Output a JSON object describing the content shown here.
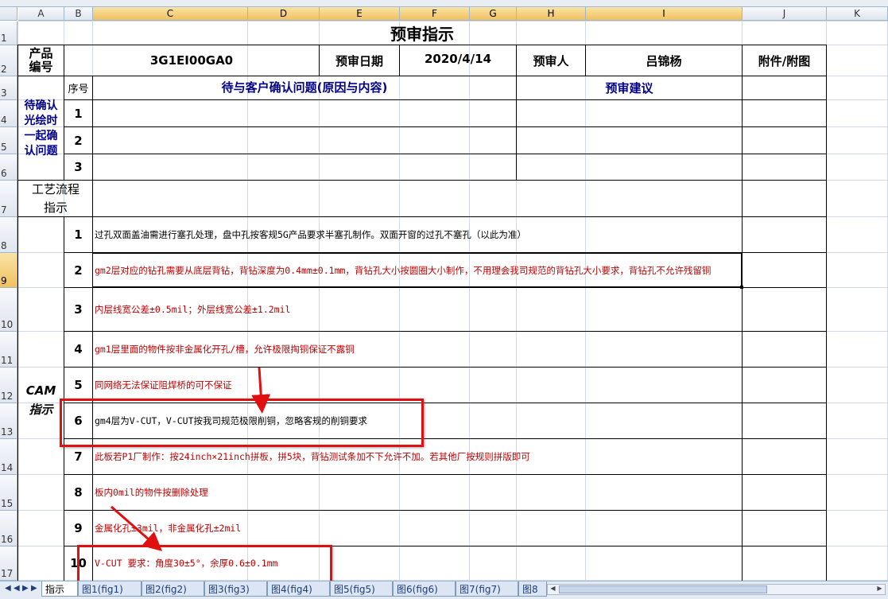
{
  "columns": [
    "A",
    "B",
    "C",
    "D",
    "E",
    "F",
    "G",
    "H",
    "I",
    "J",
    "K"
  ],
  "rows": [
    "1",
    "2",
    "3",
    "4",
    "5",
    "6",
    "7",
    "8",
    "9",
    "10",
    "11",
    "12",
    "13",
    "14",
    "15",
    "16",
    "17"
  ],
  "title": "预审指示",
  "header_row": {
    "product_label": "产品\n编号",
    "product_code": "3G1EI00GA0",
    "date_label": "预审日期",
    "date_value": "2020/4/14",
    "reviewer_label": "预审人",
    "reviewer_name": "吕锦杨",
    "attachment_label": "附件/附图"
  },
  "confirm_section": {
    "side_label": "待确认\n光绘时\n一起确\n认问题",
    "seq_header": "序号",
    "issue_header": "待与客户确认问题(原因与内容)",
    "suggestion_header": "预审建议",
    "numbers": [
      "1",
      "2",
      "3"
    ]
  },
  "process_label": "工艺流程\n指示",
  "cam_label": "CAM\n指示",
  "cam_items": [
    {
      "no": "1",
      "text": "过孔双面盖油需进行塞孔处理，盘中孔按客规5G产品要求半塞孔制作。双面开窗的过孔不塞孔（以此为准）",
      "color": "black"
    },
    {
      "no": "2",
      "text": "gm2层对应的钻孔需要从底层背钻，背钻深度为0.4mm±0.1mm，背钻孔大小按圆圈大小制作，不用理会我司规范的背钻孔大小要求，背钻孔不允许残留铜",
      "color": "red"
    },
    {
      "no": "3",
      "text": "内层线宽公差±0.5mil；外层线宽公差±1.2mil",
      "color": "red"
    },
    {
      "no": "4",
      "text": "gm1层里面的物件按非金属化开孔/槽，允许极限掏铜保证不露铜",
      "color": "red"
    },
    {
      "no": "5",
      "text": "同网络无法保证阻焊桥的可不保证",
      "color": "red"
    },
    {
      "no": "6",
      "text": "gm4层为V-CUT，V-CUT按我司规范极限削铜，忽略客规的削铜要求",
      "color": "black"
    },
    {
      "no": "7",
      "text": "此板若P1厂制作：按24inch×21inch拼板，拼5块，背钻测试条加不下允许不加。若其他厂按规则拼版即可",
      "color": "red"
    },
    {
      "no": "8",
      "text": "板内0mil的物件按删除处理",
      "color": "red"
    },
    {
      "no": "9",
      "text": "金属化孔±3mil，非金属化孔±2mil",
      "color": "red"
    },
    {
      "no": "10",
      "text": "V-CUT 要求：角度30±5°，余厚0.6±0.1mm",
      "color": "red"
    }
  ],
  "sheet_tabs": [
    "指示",
    "图1(fig1)",
    "图2(fig2)",
    "图3(fig3)",
    "图4(fig4)",
    "图5(fig5)",
    "图6(fig6)",
    "图7(fig7)",
    "图8"
  ],
  "colors": {
    "annotation": "#e01010",
    "header_blue": "#00008b",
    "red_text": "#c00000"
  }
}
